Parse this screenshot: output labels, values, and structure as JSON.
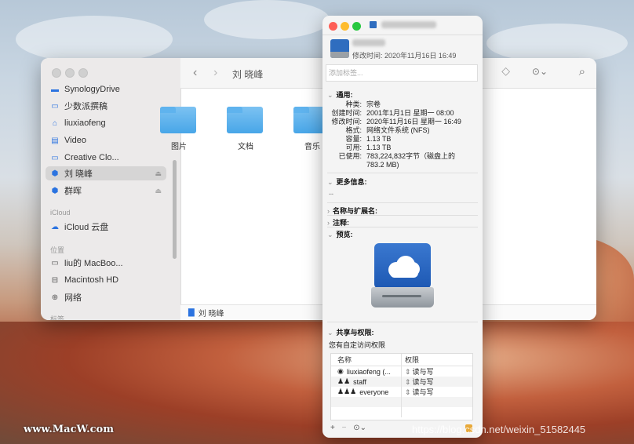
{
  "finder": {
    "title": "刘 晓峰",
    "sidebar": {
      "items": [
        {
          "label": "SynologyDrive",
          "icon": "folder-icon"
        },
        {
          "label": "少数派撰稿",
          "icon": "folder-icon"
        },
        {
          "label": "liuxiaofeng",
          "icon": "home-icon"
        },
        {
          "label": "Video",
          "icon": "video-icon"
        },
        {
          "label": "Creative Clo...",
          "icon": "folder-icon"
        },
        {
          "label": "刘 晓峰",
          "icon": "network-drive-icon"
        },
        {
          "label": "群晖",
          "icon": "network-drive-icon"
        }
      ],
      "icloud_header": "iCloud",
      "icloud_items": [
        {
          "label": "iCloud 云盘",
          "icon": "cloud-icon"
        }
      ],
      "locations_header": "位置",
      "location_items": [
        {
          "label": "liu的 MacBoo...",
          "icon": "laptop-icon"
        },
        {
          "label": "Macintosh HD",
          "icon": "disk-icon"
        },
        {
          "label": "网络",
          "icon": "globe-icon"
        }
      ],
      "tags_header": "标签"
    },
    "folders": [
      {
        "label": "图片"
      },
      {
        "label": "文档"
      },
      {
        "label": "音乐"
      }
    ],
    "path": "刘 晓峰"
  },
  "info": {
    "modified": "修改时间: 2020年11月16日 16:49",
    "tags_placeholder": "添加标签...",
    "sections": {
      "general": "通用:",
      "more_info": "更多信息:",
      "name_ext": "名称与扩展名:",
      "comments": "注释:",
      "preview": "预览:",
      "sharing": "共享与权限:"
    },
    "general": [
      {
        "k": "种类:",
        "v": "宗卷"
      },
      {
        "k": "创建时间:",
        "v": "2001年1月1日 星期一 08:00"
      },
      {
        "k": "修改时间:",
        "v": "2020年11月16日 星期一 16:49"
      },
      {
        "k": "格式:",
        "v": "网络文件系统 (NFS)"
      },
      {
        "k": "容量:",
        "v": "1.13 TB"
      },
      {
        "k": "可用:",
        "v": "1.13 TB"
      },
      {
        "k": "已使用:",
        "v": "783,224,832字节（磁盘上的"
      },
      {
        "k": "",
        "v": "783.2 MB)"
      }
    ],
    "more_info_value": "--",
    "sharing_subtitle": "您有自定访问权限",
    "table": {
      "headers": [
        "名称",
        "权限"
      ],
      "rows": [
        {
          "name": "liuxiaofeng (...",
          "perm": "读与写",
          "icon": "user-icon"
        },
        {
          "name": "staff",
          "perm": "读与写",
          "icon": "group-icon"
        },
        {
          "name": "everyone",
          "perm": "读与写",
          "icon": "everyone-icon"
        }
      ]
    },
    "buttons": {
      "add": "+",
      "remove": "−",
      "action": "⊙⌄"
    }
  },
  "watermarks": {
    "left": "www.MacW.com",
    "right": "https://blog.csdn.net/weixin_51582445"
  }
}
